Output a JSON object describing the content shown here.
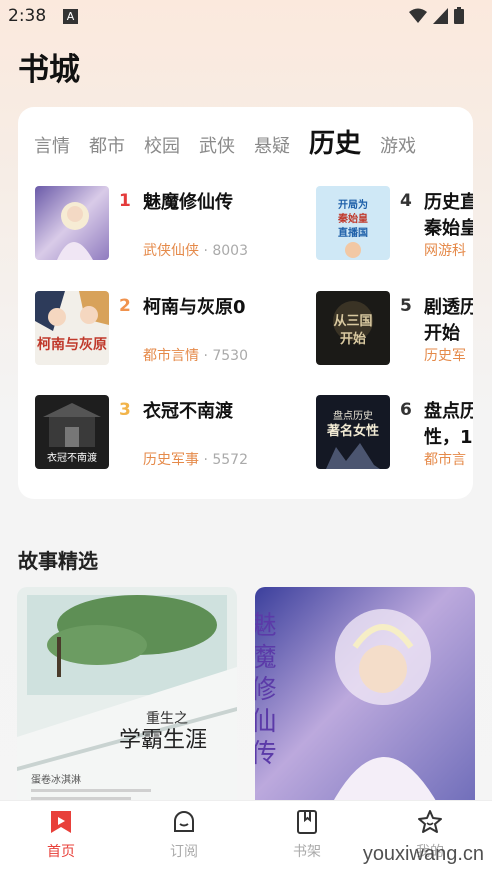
{
  "status": {
    "time": "2:38",
    "indicator": "A"
  },
  "page_title": "书城",
  "tabs": [
    {
      "label": "言情"
    },
    {
      "label": "都市"
    },
    {
      "label": "校园"
    },
    {
      "label": "武侠"
    },
    {
      "label": "悬疑"
    },
    {
      "label": "历史",
      "active": true
    },
    {
      "label": "游戏"
    }
  ],
  "ranking": [
    {
      "rank": "1",
      "title": "魅魔修仙传",
      "category": "武侠仙侠",
      "separator": "·",
      "count": "8003"
    },
    {
      "rank": "2",
      "title": "柯南与灰原0",
      "category": "都市言情",
      "separator": "·",
      "count": "7530"
    },
    {
      "rank": "3",
      "title": "衣冠不南渡",
      "category": "历史军事",
      "separator": "·",
      "count": "5572"
    },
    {
      "rank": "4",
      "title": "历史直",
      "title_line2": "秦始皇",
      "category": "网游科"
    },
    {
      "rank": "5",
      "title": "剧透历",
      "title_line2": "开始",
      "category": "历史军"
    },
    {
      "rank": "6",
      "title": "盘点历",
      "title_line2": "性，1",
      "category": "都市言"
    }
  ],
  "cover_texts": {
    "c2": "柯南与灰原",
    "c3": "衣冠不南渡",
    "c4_a": "开局为",
    "c4_b": "秦始皇",
    "c4_c": "直播国",
    "c5_a": "从三国",
    "c5_b": "开始",
    "c6_a": "盘点历史",
    "c6_b": "著名女性"
  },
  "section_title": "故事精选",
  "story_cards": [
    {
      "title_line1": "重生之",
      "title_line2": "学霸生涯",
      "author": "蛋卷冰淇淋"
    },
    {
      "title": "魅魔修仙传"
    }
  ],
  "nav": [
    {
      "label": "首页",
      "active": true
    },
    {
      "label": "订阅"
    },
    {
      "label": "书架"
    },
    {
      "label": "我的"
    }
  ],
  "watermark": "youxiwang.cn",
  "colors": {
    "accent": "#e8403a",
    "meta": "#e58a4a",
    "rank1": "#e43b3b",
    "rank2": "#f0924d",
    "rank3": "#f2b44a"
  }
}
